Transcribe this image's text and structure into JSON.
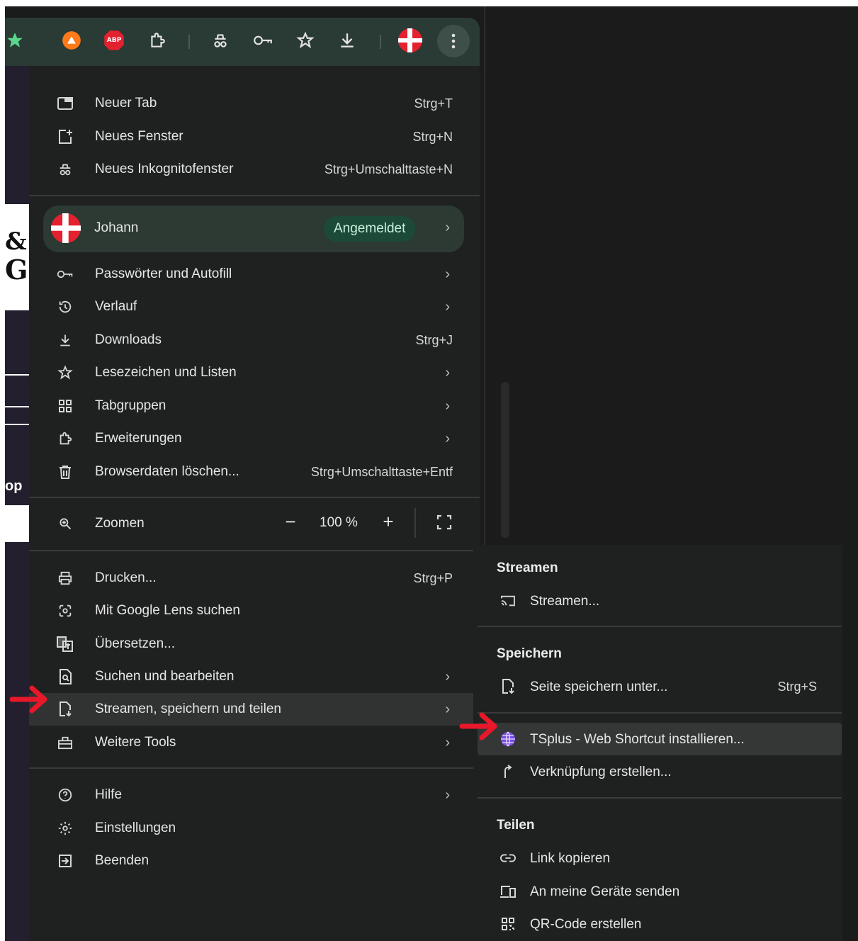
{
  "colors": {
    "accent_green": "#1c4a39",
    "arrow_red": "#e8182a",
    "menu_bg": "#1f2120",
    "highlight": "#303332"
  },
  "toolbar": {
    "icons": [
      "bookmark-star-icon",
      "avast-icon",
      "adblock-plus-icon",
      "extensions-icon",
      "incognito-icon",
      "password-key-icon",
      "bookmarks-icon",
      "download-icon",
      "profile-flag-icon",
      "more-menu-icon"
    ],
    "abp_label": "ABP"
  },
  "page_strip": {
    "text1": "&",
    "text2": "G",
    "text3": "op"
  },
  "menu": {
    "items_top": [
      {
        "label": "Neuer Tab",
        "shortcut": "Strg+T",
        "icon": "new-tab-icon"
      },
      {
        "label": "Neues Fenster",
        "shortcut": "Strg+N",
        "icon": "new-window-icon"
      },
      {
        "label": "Neues Inkognitofenster",
        "shortcut": "Strg+Umschalttaste+N",
        "icon": "incognito-icon"
      }
    ],
    "profile": {
      "name": "Johann",
      "badge": "Angemeldet"
    },
    "items_mid": [
      {
        "label": "Passwörter und Autofill",
        "icon": "key-icon"
      },
      {
        "label": "Verlauf",
        "icon": "history-icon"
      },
      {
        "label": "Downloads",
        "shortcut": "Strg+J",
        "icon": "download-icon"
      },
      {
        "label": "Lesezeichen und Listen",
        "icon": "star-icon"
      },
      {
        "label": "Tabgruppen",
        "icon": "tab-groups-icon"
      },
      {
        "label": "Erweiterungen",
        "icon": "extensions-icon"
      },
      {
        "label": "Browserdaten löschen...",
        "shortcut": "Strg+Umschalttaste+Entf",
        "icon": "trash-icon"
      }
    ],
    "zoom": {
      "label": "Zoomen",
      "minus": "−",
      "value": "100 %",
      "plus": "+"
    },
    "items_tools": [
      {
        "label": "Drucken...",
        "shortcut": "Strg+P",
        "icon": "print-icon"
      },
      {
        "label": "Mit Google Lens suchen",
        "icon": "lens-icon"
      },
      {
        "label": "Übersetzen...",
        "icon": "translate-icon"
      },
      {
        "label": "Suchen und bearbeiten",
        "icon": "find-icon"
      },
      {
        "label": "Streamen, speichern und teilen",
        "icon": "save-share-icon"
      },
      {
        "label": "Weitere Tools",
        "icon": "tools-icon"
      }
    ],
    "items_bottom": [
      {
        "label": "Hilfe",
        "icon": "help-icon"
      },
      {
        "label": "Einstellungen",
        "icon": "settings-icon"
      },
      {
        "label": "Beenden",
        "icon": "exit-icon"
      }
    ],
    "chevron": "›"
  },
  "submenu": {
    "stream_header": "Streamen",
    "stream_item": "Streamen...",
    "save_header": "Speichern",
    "save_item": "Seite speichern unter...",
    "save_shortcut": "Strg+S",
    "tsplus_item": "TSplus - Web Shortcut installieren...",
    "shortcut_item": "Verknüpfung erstellen...",
    "share_header": "Teilen",
    "copy_link": "Link kopieren",
    "send_devices": "An meine Geräte senden",
    "qr_code": "QR-Code erstellen"
  }
}
